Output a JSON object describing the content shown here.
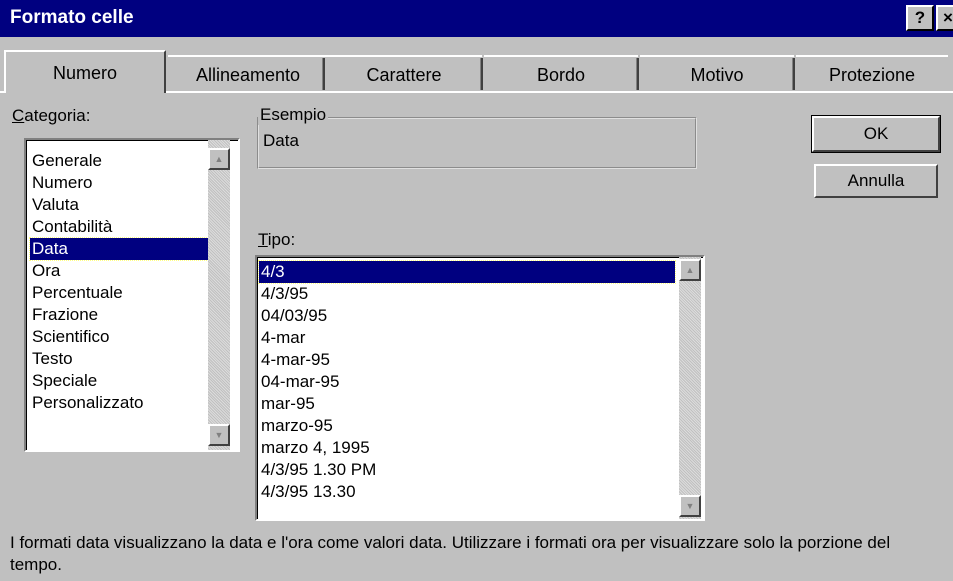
{
  "window": {
    "title": "Formato celle",
    "help_label": "?",
    "close_label": "×"
  },
  "tabs": [
    {
      "label": "Numero",
      "active": true
    },
    {
      "label": "Allineamento",
      "active": false
    },
    {
      "label": "Carattere",
      "active": false
    },
    {
      "label": "Bordo",
      "active": false
    },
    {
      "label": "Motivo",
      "active": false
    },
    {
      "label": "Protezione",
      "active": false
    }
  ],
  "category": {
    "label_accel": "C",
    "label_rest": "ategoria:",
    "items": [
      "Generale",
      "Numero",
      "Valuta",
      "Contabilità",
      "Data",
      "Ora",
      "Percentuale",
      "Frazione",
      "Scientifico",
      "Testo",
      "Speciale",
      "Personalizzato"
    ],
    "selected": "Data"
  },
  "sample": {
    "legend": "Esempio",
    "value": "Data"
  },
  "type": {
    "label_accel": "T",
    "label_rest": "ipo:",
    "items": [
      "4/3",
      "4/3/95",
      "04/03/95",
      "4-mar",
      "4-mar-95",
      "04-mar-95",
      "mar-95",
      "marzo-95",
      "marzo 4, 1995",
      "4/3/95 1.30 PM",
      "4/3/95 13.30"
    ],
    "selected": "4/3"
  },
  "buttons": {
    "ok": "OK",
    "cancel": "Annulla"
  },
  "description": "I formati data visualizzano la data e l'ora come valori data. Utilizzare i formati ora per visualizzare solo la porzione del tempo."
}
